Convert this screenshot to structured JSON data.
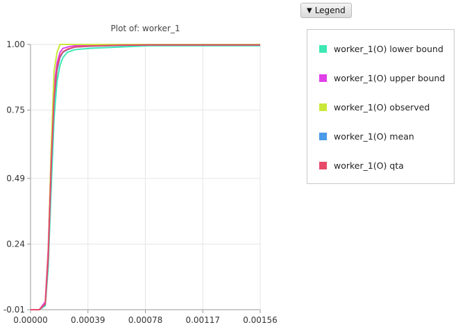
{
  "legend_button": {
    "icon": "triangle-down-icon",
    "label": "Legend"
  },
  "chart_data": {
    "type": "line",
    "title": "Plot of: worker_1",
    "xlabel": "",
    "ylabel": "",
    "xlim": [
      0,
      0.00156
    ],
    "ylim": [
      -0.01,
      1.0
    ],
    "x_ticks": [
      "0.00000",
      "0.00039",
      "0.00078",
      "0.00117",
      "0.00156"
    ],
    "y_ticks": [
      "1.00",
      "0.75",
      "0.49",
      "0.24",
      "-0.01"
    ],
    "grid": true,
    "legend_position": "right",
    "series": [
      {
        "name": "worker_1(O) lower bound",
        "color": "#3ee8b5",
        "x": [
          0,
          6e-05,
          0.0001,
          0.00012,
          0.00014,
          0.00016,
          0.00018,
          0.0002,
          0.00022,
          0.00025,
          0.0003,
          0.0004,
          0.0006,
          0.0008,
          0.00156
        ],
        "y": [
          -0.01,
          -0.01,
          0.005,
          0.15,
          0.45,
          0.72,
          0.86,
          0.92,
          0.95,
          0.97,
          0.98,
          0.985,
          0.99,
          0.995,
          0.995
        ]
      },
      {
        "name": "worker_1(O) upper bound",
        "color": "#e040e8",
        "x": [
          0,
          6e-05,
          0.0001,
          0.00012,
          0.00014,
          0.00016,
          0.00018,
          0.0002,
          0.00022,
          0.00025,
          0.0003,
          0.0004,
          0.0006,
          0.0008,
          0.00156
        ],
        "y": [
          -0.01,
          -0.01,
          0.02,
          0.22,
          0.58,
          0.84,
          0.93,
          0.97,
          0.985,
          0.99,
          0.995,
          0.997,
          0.999,
          1.0,
          1.0
        ]
      },
      {
        "name": "worker_1(O) observed",
        "color": "#c8e83a",
        "x": [
          0,
          6e-05,
          0.0001,
          0.00012,
          0.00014,
          0.00016,
          0.00018,
          0.0002,
          0.00022,
          0.00025,
          0.0003,
          0.0004,
          0.0006,
          0.0008,
          0.00156
        ],
        "y": [
          -0.01,
          -0.01,
          0.01,
          0.2,
          0.6,
          0.9,
          0.97,
          1.0,
          1.0,
          1.0,
          1.0,
          1.0,
          1.0,
          1.0,
          1.0
        ]
      },
      {
        "name": "worker_1(O) mean",
        "color": "#4a9be8",
        "x": [
          0,
          6e-05,
          0.0001,
          0.00012,
          0.00014,
          0.00016,
          0.00018,
          0.0002,
          0.00022,
          0.00025,
          0.0003,
          0.0004,
          0.0006,
          0.0008,
          0.00156
        ],
        "y": [
          -0.01,
          -0.01,
          0.01,
          0.18,
          0.52,
          0.79,
          0.9,
          0.95,
          0.97,
          0.98,
          0.99,
          0.993,
          0.996,
          0.998,
          0.998
        ]
      },
      {
        "name": "worker_1(O) qta",
        "color": "#e84a6a",
        "x": [
          0,
          6e-05,
          0.0001,
          0.00012,
          0.00014,
          0.00016,
          0.00018,
          0.0002,
          0.00022,
          0.00025,
          0.0003,
          0.0004,
          0.0006,
          0.0008,
          0.00156
        ],
        "y": [
          -0.01,
          -0.01,
          0.012,
          0.19,
          0.54,
          0.8,
          0.91,
          0.955,
          0.972,
          0.982,
          0.99,
          0.994,
          0.997,
          0.998,
          0.998
        ]
      }
    ]
  }
}
